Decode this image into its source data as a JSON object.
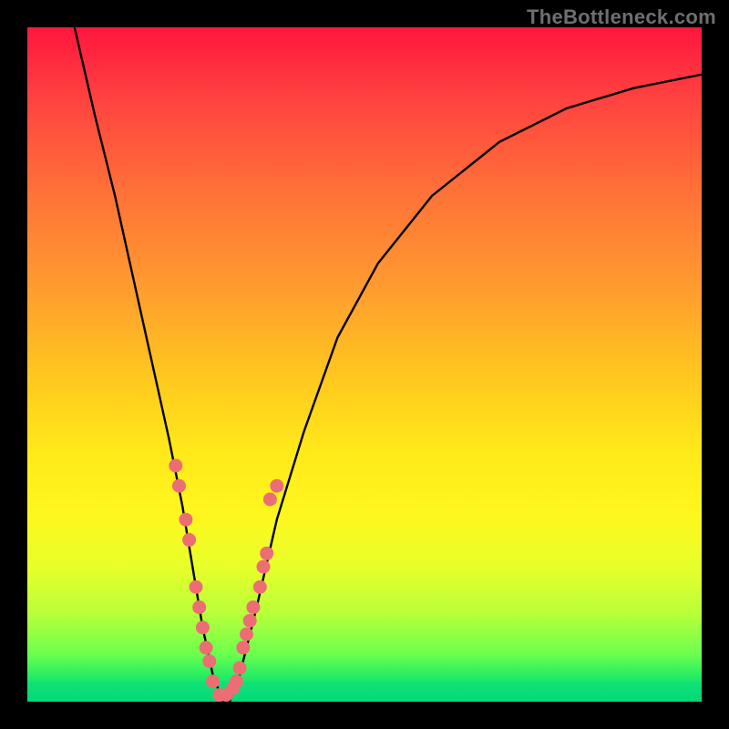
{
  "watermark": "TheBottleneck.com",
  "colors": {
    "dot_fill": "#ed6d74",
    "curve_stroke": "#000000"
  },
  "chart_data": {
    "type": "line",
    "title": "",
    "xlabel": "",
    "ylabel": "",
    "xlim": [
      0,
      100
    ],
    "ylim": [
      0,
      100
    ],
    "grid": false,
    "background": "rainbow-gradient (red→yellow→green top-to-bottom)",
    "series": [
      {
        "name": "bottleneck-curve",
        "x": [
          7,
          10,
          13,
          15,
          17,
          19,
          21,
          23,
          24.5,
          26,
          27.5,
          29,
          30,
          31.5,
          34,
          37,
          41,
          46,
          52,
          60,
          70,
          80,
          90,
          100
        ],
        "y": [
          100,
          87,
          75,
          66,
          57,
          48,
          39,
          29,
          20,
          11,
          4,
          0,
          0,
          4,
          14,
          27,
          40,
          54,
          65,
          75,
          83,
          88,
          91,
          93
        ],
        "notes": "y is bottleneck percentage (0 = no bottleneck, drawn at bottom/green). Minimum near x≈29."
      }
    ],
    "data_points": [
      {
        "x": 22.0,
        "y": 35
      },
      {
        "x": 22.5,
        "y": 32
      },
      {
        "x": 23.5,
        "y": 27
      },
      {
        "x": 24.0,
        "y": 24
      },
      {
        "x": 25.0,
        "y": 17
      },
      {
        "x": 25.5,
        "y": 14
      },
      {
        "x": 26.0,
        "y": 11
      },
      {
        "x": 26.5,
        "y": 8
      },
      {
        "x": 27.0,
        "y": 6
      },
      {
        "x": 27.5,
        "y": 3
      },
      {
        "x": 28.5,
        "y": 1
      },
      {
        "x": 29.5,
        "y": 1
      },
      {
        "x": 30.5,
        "y": 2
      },
      {
        "x": 31.0,
        "y": 3
      },
      {
        "x": 31.5,
        "y": 5
      },
      {
        "x": 32.0,
        "y": 8
      },
      {
        "x": 32.5,
        "y": 10
      },
      {
        "x": 33.0,
        "y": 12
      },
      {
        "x": 33.5,
        "y": 14
      },
      {
        "x": 34.5,
        "y": 17
      },
      {
        "x": 35.0,
        "y": 20
      },
      {
        "x": 35.5,
        "y": 22
      },
      {
        "x": 36.0,
        "y": 30
      },
      {
        "x": 37.0,
        "y": 32
      }
    ]
  }
}
